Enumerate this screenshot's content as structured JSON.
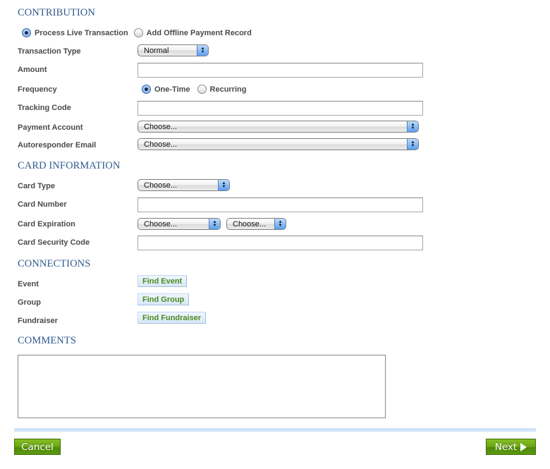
{
  "contribution": {
    "title": "CONTRIBUTION",
    "mode_options": [
      {
        "label": "Process Live Transaction",
        "checked": true
      },
      {
        "label": "Add Offline Payment Record",
        "checked": false
      }
    ],
    "transaction_type": {
      "label": "Transaction Type",
      "value": "Normal"
    },
    "amount": {
      "label": "Amount",
      "value": ""
    },
    "frequency": {
      "label": "Frequency",
      "options": [
        {
          "label": "One-Time",
          "checked": true
        },
        {
          "label": "Recurring",
          "checked": false
        }
      ]
    },
    "tracking_code": {
      "label": "Tracking Code",
      "value": ""
    },
    "payment_account": {
      "label": "Payment Account",
      "value": "Choose..."
    },
    "autoresponder_email": {
      "label": "Autoresponder Email",
      "value": "Choose..."
    }
  },
  "card": {
    "title": "CARD INFORMATION",
    "card_type": {
      "label": "Card Type",
      "value": "Choose..."
    },
    "card_number": {
      "label": "Card Number",
      "value": ""
    },
    "card_expiration": {
      "label": "Card Expiration",
      "month": "Choose...",
      "year": "Choose..."
    },
    "security_code": {
      "label": "Card Security Code",
      "value": ""
    }
  },
  "connections": {
    "title": "CONNECTIONS",
    "event": {
      "label": "Event",
      "button": "Find Event"
    },
    "group": {
      "label": "Group",
      "button": "Find Group"
    },
    "fundraiser": {
      "label": "Fundraiser",
      "button": "Find Fundraiser"
    }
  },
  "comments": {
    "title": "COMMENTS",
    "value": ""
  },
  "footer": {
    "cancel_label": "Cancel",
    "next_label": "Next"
  },
  "colors": {
    "section_title": "#2f5a8c",
    "button_green": "#6aa512",
    "link_green": "#4f8a1a",
    "divider": "#cfe4f8"
  }
}
